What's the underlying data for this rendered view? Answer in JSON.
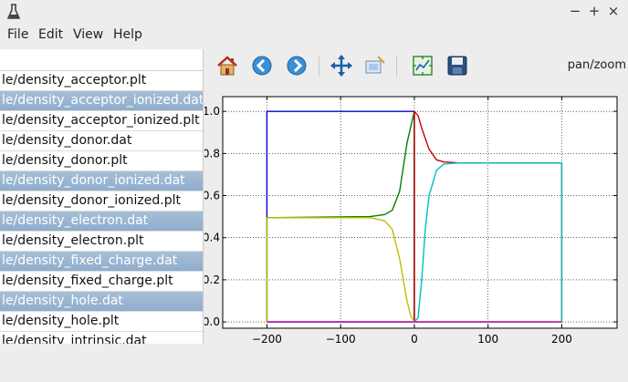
{
  "window": {
    "minimize": "−",
    "maximize": "+",
    "close": "×"
  },
  "menu": [
    "File",
    "Edit",
    "View",
    "Help"
  ],
  "files": [
    {
      "name": "le/density_acceptor.plt",
      "selected": false
    },
    {
      "name": "le/density_acceptor_ionized.dat",
      "selected": true
    },
    {
      "name": "le/density_acceptor_ionized.plt",
      "selected": false
    },
    {
      "name": "le/density_donor.dat",
      "selected": false
    },
    {
      "name": "le/density_donor.plt",
      "selected": false
    },
    {
      "name": "le/density_donor_ionized.dat",
      "selected": true
    },
    {
      "name": "le/density_donor_ionized.plt",
      "selected": false
    },
    {
      "name": "le/density_electron.dat",
      "selected": true
    },
    {
      "name": "le/density_electron.plt",
      "selected": false
    },
    {
      "name": "le/density_fixed_charge.dat",
      "selected": true
    },
    {
      "name": "le/density_fixed_charge.plt",
      "selected": false
    },
    {
      "name": "le/density_hole.dat",
      "selected": true
    },
    {
      "name": "le/density_hole.plt",
      "selected": false
    },
    {
      "name": "le/density_intrinsic.dat",
      "selected": false
    }
  ],
  "toolbar": {
    "buttons": [
      "home-icon",
      "back-icon",
      "forward-icon",
      "pan-icon",
      "zoom-icon",
      "subplots-icon",
      "save-icon"
    ],
    "mode": "pan/zoom"
  },
  "chart_data": {
    "type": "line",
    "xlim": [
      -260,
      275
    ],
    "ylim": [
      -0.03,
      1.07
    ],
    "xticks": [
      -200,
      -100,
      0,
      100,
      200
    ],
    "xtick_labels": [
      "−200",
      "−100",
      "0",
      "100",
      "200"
    ],
    "yticks": [
      0.0,
      0.2,
      0.4,
      0.6,
      0.8,
      1.0
    ],
    "ytick_labels": [
      "0.0",
      "0.2",
      "0.4",
      "0.6",
      "0.8",
      "1.0"
    ],
    "grid": true,
    "series": [
      {
        "color": "#0000cc",
        "x": [
          -200,
          -200,
          0,
          0
        ],
        "y": [
          0,
          1,
          1,
          0
        ]
      },
      {
        "color": "#008000",
        "x": [
          -200,
          -200,
          -60,
          -40,
          -30,
          -20,
          -10,
          0,
          0,
          200
        ],
        "y": [
          0,
          0.495,
          0.5,
          0.51,
          0.53,
          0.62,
          0.85,
          1.0,
          0,
          0
        ]
      },
      {
        "color": "#cc0000",
        "x": [
          -200,
          0,
          0,
          5,
          10,
          20,
          30,
          40,
          60,
          200,
          200
        ],
        "y": [
          0,
          0,
          1.0,
          0.98,
          0.92,
          0.82,
          0.77,
          0.76,
          0.755,
          0.755,
          0
        ]
      },
      {
        "color": "#00bfbf",
        "x": [
          -200,
          0,
          5,
          10,
          15,
          20,
          30,
          40,
          60,
          200,
          200
        ],
        "y": [
          0,
          0,
          0.02,
          0.2,
          0.45,
          0.6,
          0.72,
          0.75,
          0.755,
          0.755,
          0
        ]
      },
      {
        "color": "#bfbf00",
        "x": [
          -200,
          -200,
          -60,
          -40,
          -30,
          -20,
          -15,
          -10,
          -5,
          0,
          200
        ],
        "y": [
          0,
          0.495,
          0.495,
          0.48,
          0.44,
          0.3,
          0.2,
          0.1,
          0.03,
          0,
          0
        ]
      },
      {
        "color": "#bf00bf",
        "x": [
          -200,
          200
        ],
        "y": [
          0,
          0
        ]
      }
    ]
  }
}
